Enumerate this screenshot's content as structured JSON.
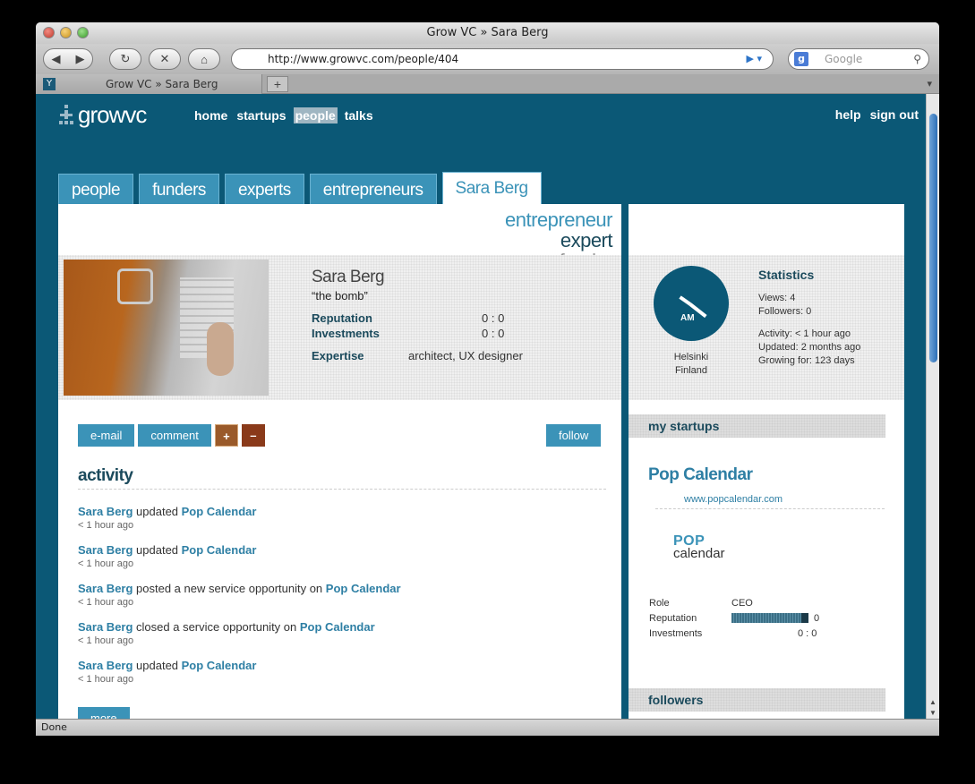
{
  "browser": {
    "title": "Grow VC » Sara Berg",
    "back": "◀",
    "forward": "▶",
    "reload": "↻",
    "stop": "✕",
    "home": "⌂",
    "url": "http://www.growvc.com/people/404",
    "url_go": "▶ ▾",
    "search_placeholder": "Google",
    "search_engine": "g",
    "search_icon": "⚲",
    "tab_label": "Grow VC » Sara Berg",
    "new_tab": "+",
    "status": "Done"
  },
  "site": {
    "logo": "growvc",
    "nav": [
      "home",
      "startups",
      "people",
      "talks"
    ],
    "active_nav": "people",
    "right_nav": [
      "help",
      "sign out"
    ]
  },
  "tabs": [
    "people",
    "funders",
    "experts",
    "entrepreneurs",
    "Sara Berg"
  ],
  "profile": {
    "roles": [
      "entrepreneur",
      "expert",
      "funder"
    ],
    "name": "Sara Berg",
    "tagline": "“the bomb”",
    "reputation_label": "Reputation",
    "reputation_value": "0 : 0",
    "investments_label": "Investments",
    "investments_value": "0 : 0",
    "expertise_label": "Expertise",
    "expertise_value": "architect, UX designer"
  },
  "actions": {
    "email": "e-mail",
    "comment": "comment",
    "plus": "+",
    "minus": "–",
    "follow": "follow"
  },
  "activity": {
    "title": "activity",
    "items": [
      {
        "user": "Sara Berg",
        "verb": " updated ",
        "target": "Pop Calendar",
        "time": "< 1 hour ago"
      },
      {
        "user": "Sara Berg",
        "verb": " updated ",
        "target": "Pop Calendar",
        "time": "< 1 hour ago"
      },
      {
        "user": "Sara Berg",
        "verb": " posted a new service opportunity on ",
        "target": "Pop Calendar",
        "time": "< 1 hour ago"
      },
      {
        "user": "Sara Berg",
        "verb": " closed a service opportunity on ",
        "target": "Pop Calendar",
        "time": "< 1 hour ago"
      },
      {
        "user": "Sara Berg",
        "verb": " updated ",
        "target": "Pop Calendar",
        "time": "< 1 hour ago"
      }
    ],
    "more": "more"
  },
  "sidebar": {
    "clock_ampm": "AM",
    "city": "Helsinki",
    "country": "Finland",
    "stats_title": "Statistics",
    "views": "Views: 4",
    "followers": "Followers: 0",
    "activity": "Activity: < 1 hour ago",
    "updated": "Updated: 2 months ago",
    "growing": "Growing for: 123 days",
    "my_startups": "my startups",
    "startup_name": "Pop Calendar",
    "startup_url": "www.popcalendar.com",
    "startup_logo_1": "POP",
    "startup_logo_2": "calendar",
    "role_label": "Role",
    "role_value": "CEO",
    "reputation_label": "Reputation",
    "reputation_value": "0",
    "investments_label": "Investments",
    "investments_value": "0 : 0",
    "followers_heading": "followers"
  }
}
